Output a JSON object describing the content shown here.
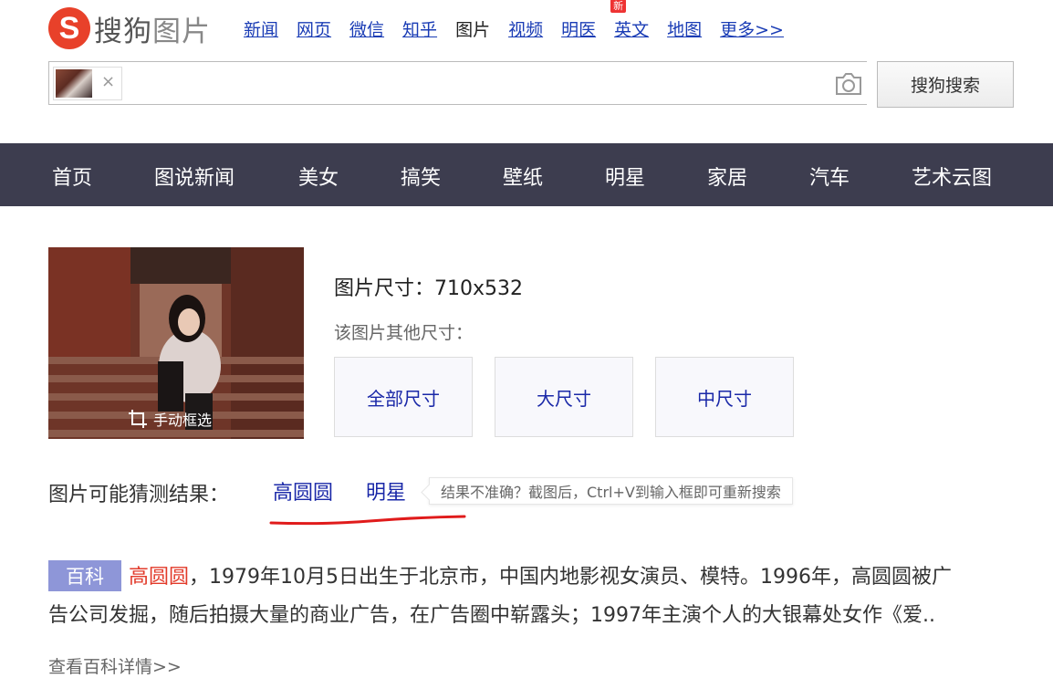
{
  "logo": {
    "mark": "S",
    "text_part1": "搜狗",
    "text_part2": "图片"
  },
  "topnav": {
    "items": [
      {
        "label": "新闻"
      },
      {
        "label": "网页"
      },
      {
        "label": "微信"
      },
      {
        "label": "知乎"
      },
      {
        "label": "图片",
        "active": true
      },
      {
        "label": "视频"
      },
      {
        "label": "明医"
      },
      {
        "label": "英文",
        "badge": "新"
      },
      {
        "label": "地图"
      },
      {
        "label": "更多>>"
      }
    ]
  },
  "search": {
    "thumb_close": "×",
    "button_label": "搜狗搜索",
    "camera_icon": "camera-icon"
  },
  "categories": [
    "首页",
    "图说新闻",
    "美女",
    "搞笑",
    "壁纸",
    "明星",
    "家居",
    "汽车",
    "艺术云图"
  ],
  "image_info": {
    "crop_label": "手动框选",
    "size_title": "图片尺寸：710x532",
    "other_sizes_label": "该图片其他尺寸：",
    "size_buttons": [
      "全部尺寸",
      "大尺寸",
      "中尺寸"
    ]
  },
  "guess": {
    "label": "图片可能猜测结果：",
    "results": [
      "高圆圆",
      "明星"
    ],
    "tip": "结果不准确？截图后，Ctrl+V到输入框即可重新搜索"
  },
  "baike": {
    "tag": "百科",
    "name": "高圆圆",
    "text_line1": "，1979年10月5日出生于北京市，中国内地影视女演员、模特。1996年，高圆圆被广",
    "text_line2": "告公司发掘，随后拍摄大量的商业广告，在广告圈中崭露头；1997年主演个人的大银幕处女作《爱..",
    "more_link": "查看百科详情>>"
  },
  "colors": {
    "brand_red": "#e8412a",
    "nav_bar": "#3d3d4f",
    "link_blue": "#1a28a8",
    "baike_tag": "#8e96d8",
    "underline_red": "#e01b1b"
  }
}
